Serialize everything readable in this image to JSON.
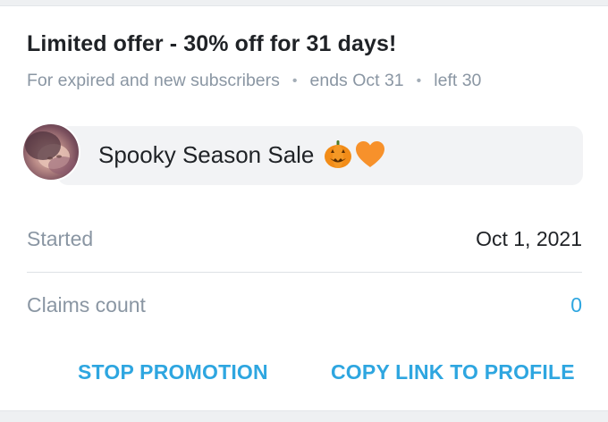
{
  "promotion": {
    "title": "Limited offer - 30% off for 31 days!",
    "audience": "For expired and new subscribers",
    "ends": "ends Oct 31",
    "left": "left 30",
    "separator": "•",
    "message": "Spooky Season Sale",
    "message_emojis": [
      "jack-o-lantern-icon",
      "orange-heart-icon"
    ]
  },
  "details": {
    "started_label": "Started",
    "started_value": "Oct 1, 2021",
    "claims_label": "Claims count",
    "claims_value": "0"
  },
  "actions": {
    "stop_label": "STOP PROMOTION",
    "copy_label": "COPY LINK TO PROFILE"
  },
  "colors": {
    "accent": "#2ea6e0",
    "muted_text": "#8a96a3",
    "primary_text": "#1f2226",
    "bubble_bg": "#f2f3f5"
  }
}
